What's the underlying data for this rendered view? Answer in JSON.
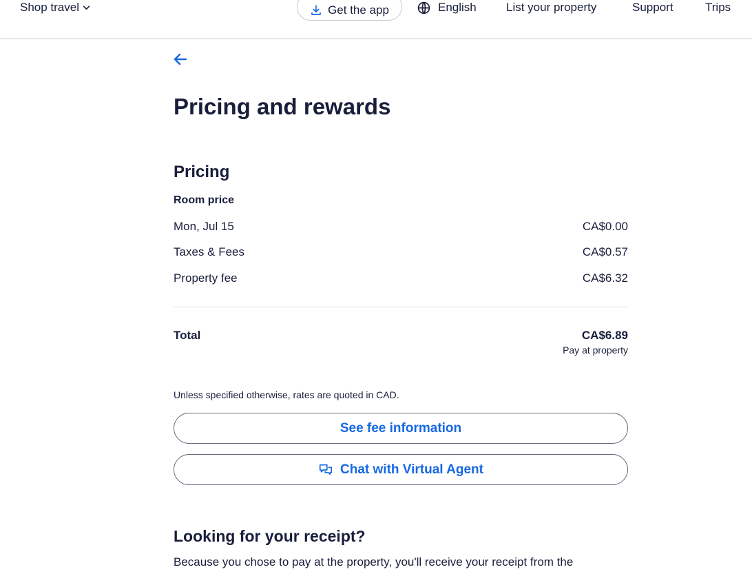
{
  "header": {
    "shop_travel": "Shop travel",
    "get_app": "Get the app",
    "language": "English",
    "list_property": "List your property",
    "support": "Support",
    "trips": "Trips"
  },
  "page": {
    "title": "Pricing and rewards"
  },
  "pricing": {
    "section_title": "Pricing",
    "room_price_label": "Room price",
    "rows": [
      {
        "label": "Mon, Jul 15",
        "value": "CA$0.00"
      },
      {
        "label": "Taxes & Fees",
        "value": "CA$0.57"
      },
      {
        "label": "Property fee",
        "value": "CA$6.32"
      }
    ],
    "total_label": "Total",
    "total_value": "CA$6.89",
    "total_note": "Pay at property",
    "currency_note": "Unless specified otherwise, rates are quoted in CAD."
  },
  "buttons": {
    "fee_info": "See fee information",
    "chat": "Chat with Virtual Agent"
  },
  "receipt": {
    "title": "Looking for your receipt?",
    "text": "Because you chose to pay at the property, you'll receive your receipt from the property when you complete the stay."
  },
  "colors": {
    "accent": "#1668e3",
    "text": "#191e3b",
    "divider": "#dfe0e4"
  }
}
